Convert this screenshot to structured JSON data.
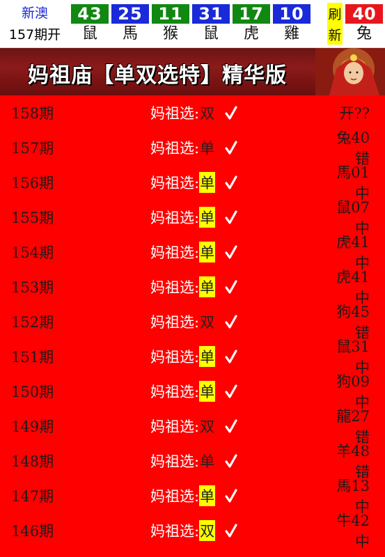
{
  "header": {
    "site": "新澳",
    "issue": "157期开",
    "balls": [
      {
        "num": "43",
        "zodiac": "鼠",
        "color": "#118811"
      },
      {
        "num": "25",
        "zodiac": "馬",
        "color": "#1a2ad8"
      },
      {
        "num": "11",
        "zodiac": "猴",
        "color": "#118811"
      },
      {
        "num": "31",
        "zodiac": "鼠",
        "color": "#1a2ad8"
      },
      {
        "num": "17",
        "zodiac": "虎",
        "color": "#118811"
      },
      {
        "num": "10",
        "zodiac": "雞",
        "color": "#1a2ad8"
      }
    ],
    "refresh_top": "刷",
    "refresh_bottom": "新",
    "special": {
      "num": "40",
      "zodiac": "兔",
      "color": "#e8161c"
    }
  },
  "banner": {
    "title": "妈祖庙【单双选特】精华版"
  },
  "rows": [
    {
      "issue": "158期",
      "label": "妈祖选:",
      "value": "双",
      "highlight": false,
      "result": "开??"
    },
    {
      "issue": "157期",
      "label": "妈祖选:",
      "value": "单",
      "highlight": false,
      "result": "兔40错"
    },
    {
      "issue": "156期",
      "label": "妈祖选:",
      "value": "单",
      "highlight": true,
      "result": "馬01中"
    },
    {
      "issue": "155期",
      "label": "妈祖选:",
      "value": "单",
      "highlight": true,
      "result": "鼠07中"
    },
    {
      "issue": "154期",
      "label": "妈祖选:",
      "value": "单",
      "highlight": true,
      "result": "虎41中"
    },
    {
      "issue": "153期",
      "label": "妈祖选:",
      "value": "单",
      "highlight": true,
      "result": "虎41中"
    },
    {
      "issue": "152期",
      "label": "妈祖选:",
      "value": "双",
      "highlight": false,
      "result": "狗45错"
    },
    {
      "issue": "151期",
      "label": "妈祖选:",
      "value": "单",
      "highlight": true,
      "result": "鼠31中"
    },
    {
      "issue": "150期",
      "label": "妈祖选:",
      "value": "单",
      "highlight": true,
      "result": "狗09中"
    },
    {
      "issue": "149期",
      "label": "妈祖选:",
      "value": "双",
      "highlight": false,
      "result": "龍27错"
    },
    {
      "issue": "148期",
      "label": "妈祖选:",
      "value": "单",
      "highlight": false,
      "result": "羊48错"
    },
    {
      "issue": "147期",
      "label": "妈祖选:",
      "value": "单",
      "highlight": true,
      "result": "馬13中"
    },
    {
      "issue": "146期",
      "label": "妈祖选:",
      "value": "双",
      "highlight": true,
      "result": "牛42中"
    }
  ]
}
